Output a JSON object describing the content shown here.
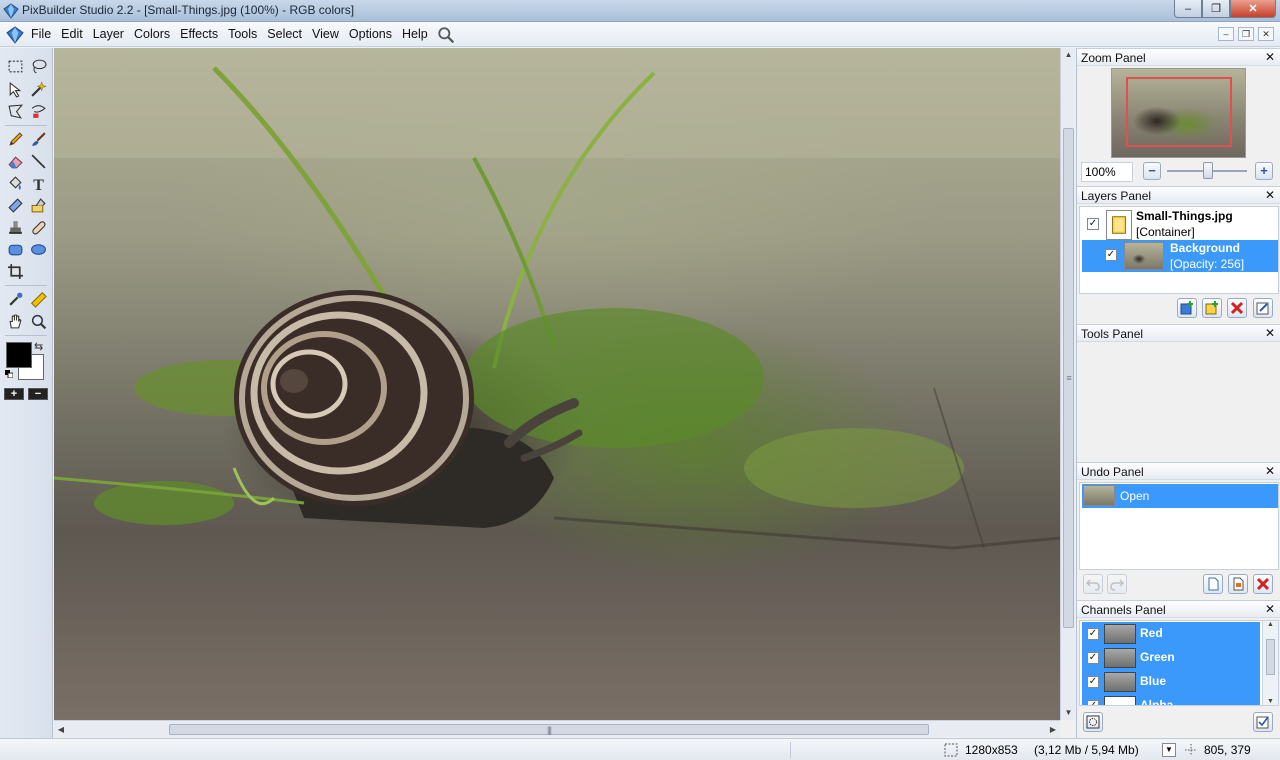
{
  "window": {
    "title": "PixBuilder Studio 2.2 - [Small-Things.jpg (100%) - RGB colors]",
    "min_glyph": "–",
    "max_glyph": "❐",
    "close_glyph": "✕"
  },
  "menu": {
    "items": [
      "File",
      "Edit",
      "Layer",
      "Colors",
      "Effects",
      "Tools",
      "Select",
      "View",
      "Options",
      "Help"
    ],
    "mdi_min": "–",
    "mdi_restore": "❐",
    "mdi_close": "✕"
  },
  "toolbox": {
    "colors": {
      "foreground": "#000000",
      "background": "#ffffff"
    },
    "zoom_in_label": "+",
    "zoom_out_label": "−",
    "swap_glyph": "⇆"
  },
  "panels": {
    "zoom": {
      "title": "Zoom Panel",
      "close": "✕",
      "value": "100%",
      "minus": "−",
      "plus": "+"
    },
    "layers": {
      "title": "Layers Panel",
      "close": "✕",
      "container": {
        "name": "Small-Things.jpg",
        "sub": "[Container]",
        "checked": "✓"
      },
      "background": {
        "name": "Background",
        "sub": "[Opacity: 256]",
        "checked": "✓"
      }
    },
    "tools": {
      "title": "Tools Panel",
      "close": "✕"
    },
    "undo": {
      "title": "Undo Panel",
      "close": "✕",
      "items": [
        "Open"
      ]
    },
    "channels": {
      "title": "Channels Panel",
      "close": "✕",
      "items": [
        {
          "name": "Red",
          "checked": "✓"
        },
        {
          "name": "Green",
          "checked": "✓"
        },
        {
          "name": "Blue",
          "checked": "✓"
        },
        {
          "name": "Alpha",
          "checked": "✓"
        }
      ]
    }
  },
  "status": {
    "image_size": "1280x853",
    "memory": "(3,12 Mb / 5,94 Mb)",
    "cursor": "805, 379"
  },
  "accent": "#3b99fc"
}
